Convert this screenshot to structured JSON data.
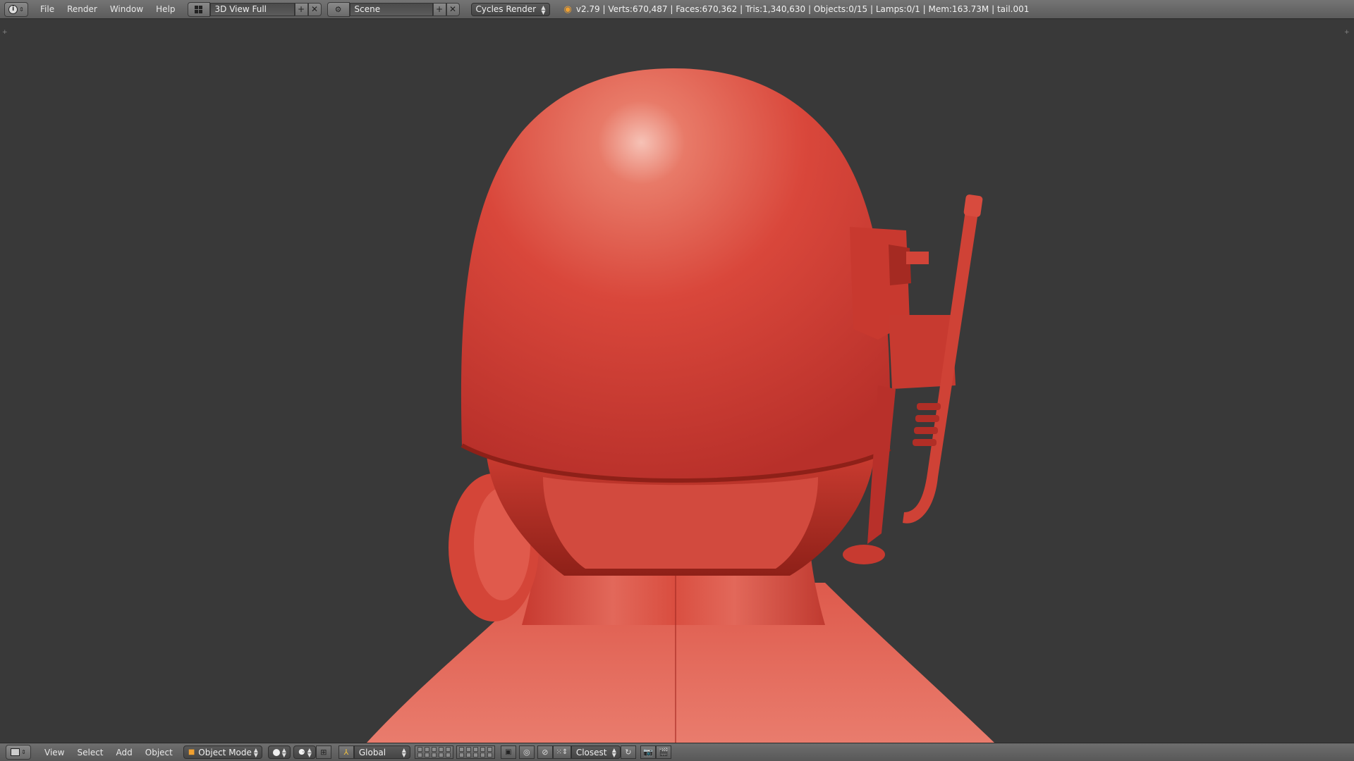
{
  "topbar": {
    "menus": [
      "File",
      "Render",
      "Window",
      "Help"
    ],
    "layout_value": "3D View Full",
    "scene_value": "Scene",
    "engine_value": "Cycles Render",
    "stats": "v2.79 | Verts:670,487 | Faces:670,362 | Tris:1,340,630 | Objects:0/15 | Lamps:0/1 | Mem:163.73M | tail.001"
  },
  "bottombar": {
    "menus": [
      "View",
      "Select",
      "Add",
      "Object"
    ],
    "mode_value": "Object Mode",
    "orientation_value": "Global",
    "snap_value": "Closest"
  },
  "colors": {
    "viewport_bg": "#393939",
    "model_red": "#d9473b",
    "model_highlight": "#f2a194"
  },
  "icons": [
    "info-icon",
    "screen-layout-icon",
    "add-icon",
    "close-icon",
    "scene-icon",
    "blender-icon",
    "editor-type-icon",
    "object-mode-icon",
    "shading-icon",
    "pivot-icon",
    "manipulator-icon",
    "orientation-icon",
    "layers-icon",
    "lock-icon",
    "snap-icon",
    "render-icon"
  ]
}
